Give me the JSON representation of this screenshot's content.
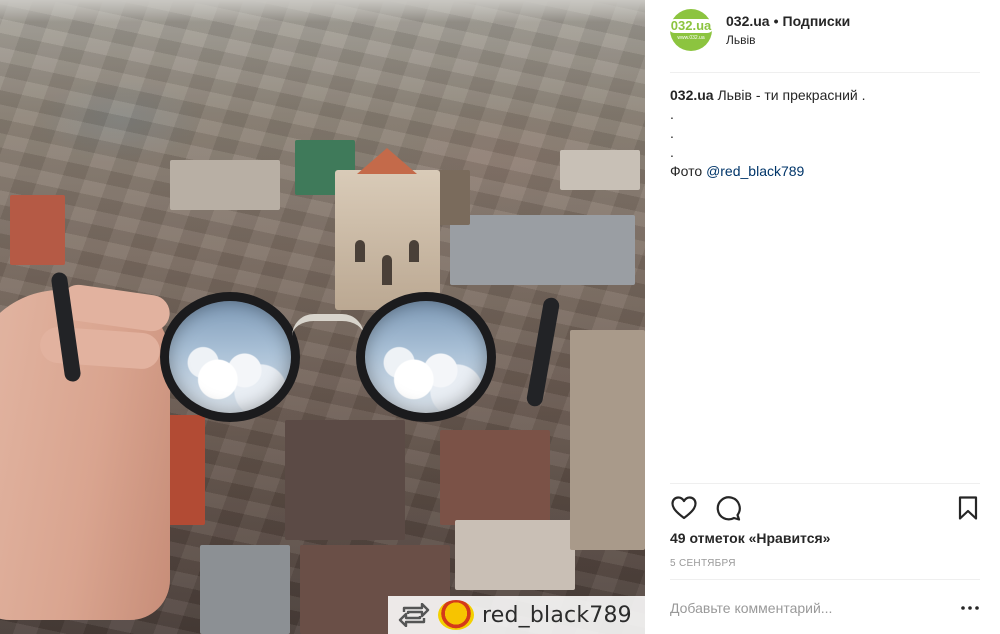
{
  "post": {
    "account": "032.ua",
    "separator": "•",
    "follow_state": "Подписки",
    "location": "Львів",
    "avatar_logo_text": "032.ua",
    "avatar_site_text": "www.032.ua"
  },
  "caption": {
    "user": "032.ua",
    "text": "Львів - ти прекрасний .",
    "dots": [
      ".",
      ".",
      "."
    ],
    "photo_label": "Фото",
    "photo_credit": "@red_black789"
  },
  "stats": {
    "likes": "49 отметок «Нравится»",
    "date": "5 СЕНТЯБРЯ"
  },
  "comment": {
    "placeholder": "Добавьте комментарий..."
  },
  "icons": {
    "like": "heart-icon",
    "comment": "comment-bubble-icon",
    "save": "bookmark-icon",
    "more": "more-options-icon",
    "repost": "repost-icon"
  },
  "watermark": {
    "username": "red_black789"
  },
  "colors": {
    "avatar_bg": "#8cc43f",
    "link": "#003569",
    "muted": "#999999",
    "text": "#262626"
  }
}
